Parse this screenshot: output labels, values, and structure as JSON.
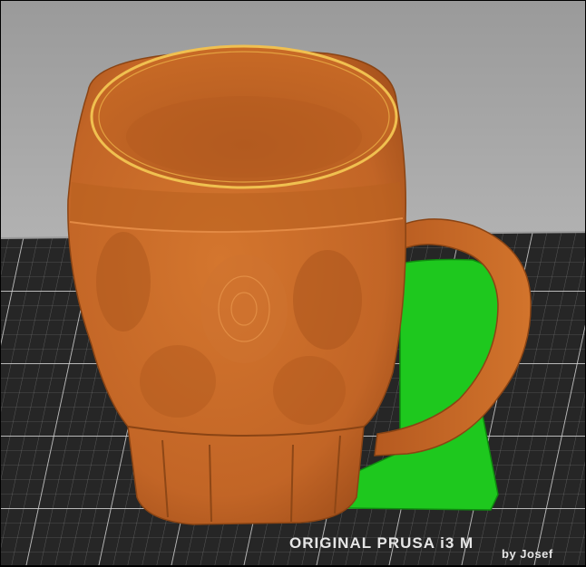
{
  "viewport": {
    "bed_label": "ORIGINAL PRUSA i3 M",
    "bed_sublabel": "by Josef"
  },
  "colors": {
    "model": "#c86a26",
    "model_shadow": "#8a4414",
    "support": "#1ec81e",
    "bed": "#262626",
    "grid": "#bfbfbf",
    "background_top": "#9c9c9c",
    "background_bottom": "#cfcfcf"
  }
}
